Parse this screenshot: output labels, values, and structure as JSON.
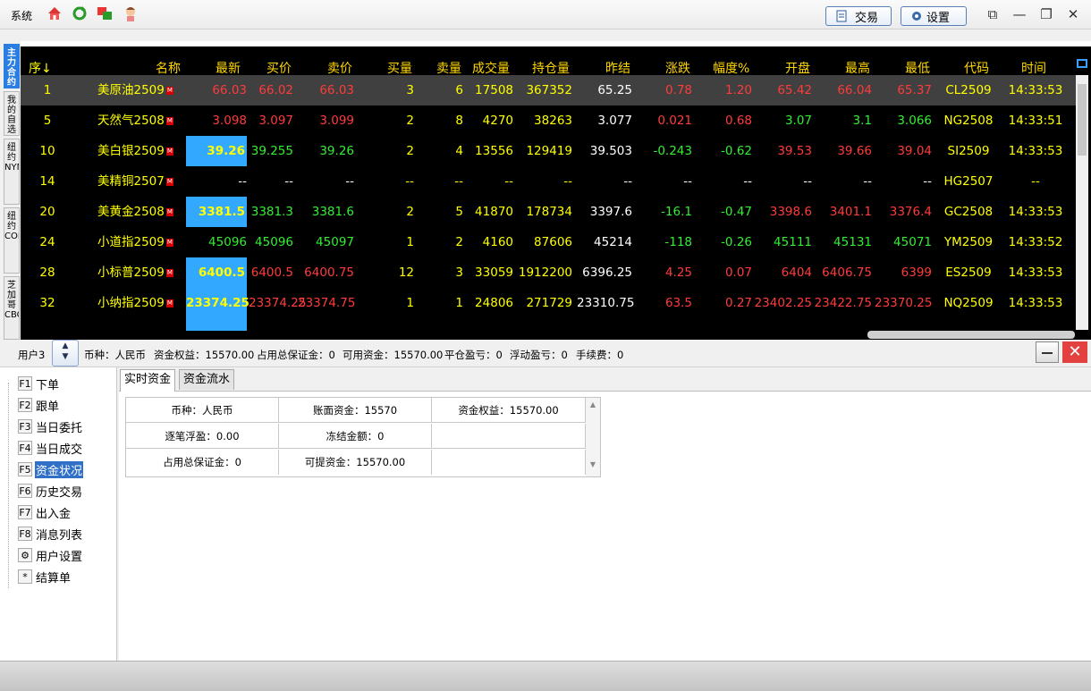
{
  "titlebar": {
    "menu_system": "系统",
    "icons": [
      "home-icon",
      "refresh-icon",
      "windows-icon",
      "user-avatar-icon"
    ],
    "trade_label": "交易",
    "settings_label": "设置"
  },
  "side_tabs": [
    "主力合约",
    "我的自选",
    "纽约NYMEX",
    "纽约COMEX",
    "芝加哥CBOT"
  ],
  "grid": {
    "headers": [
      "序↓",
      "名称",
      "最新",
      "买价",
      "卖价",
      "买量",
      "卖量",
      "成交量",
      "持仓量",
      "昨结",
      "涨跌",
      "幅度%",
      "开盘",
      "最高",
      "最低",
      "代码",
      "时间"
    ],
    "rows": [
      {
        "seq": "1",
        "name": "美原油2509",
        "last": "66.03",
        "bid": "66.02",
        "ask": "66.03",
        "bidv": "3",
        "askv": "6",
        "vol": "17508",
        "oi": "367352",
        "pre": "65.25",
        "chg": "0.78",
        "pct": "1.20",
        "open": "65.42",
        "high": "66.04",
        "low": "65.37",
        "code": "CL2509",
        "time": "14:33:53",
        "dir": "up",
        "hi": false
      },
      {
        "seq": "5",
        "name": "天然气2508",
        "last": "3.098",
        "bid": "3.097",
        "ask": "3.099",
        "bidv": "2",
        "askv": "8",
        "vol": "4270",
        "oi": "38263",
        "pre": "3.077",
        "chg": "0.021",
        "pct": "0.68",
        "open": "3.07",
        "high": "3.1",
        "low": "3.066",
        "code": "NG2508",
        "time": "14:33:51",
        "dir": "up",
        "hi": false
      },
      {
        "seq": "10",
        "name": "美白银2509",
        "last": "39.26",
        "bid": "39.255",
        "ask": "39.26",
        "bidv": "2",
        "askv": "4",
        "vol": "13556",
        "oi": "129419",
        "pre": "39.503",
        "chg": "-0.243",
        "pct": "-0.62",
        "open": "39.53",
        "high": "39.66",
        "low": "39.04",
        "code": "SI2509",
        "time": "14:33:53",
        "dir": "down",
        "hi": true
      },
      {
        "seq": "14",
        "name": "美精铜2507",
        "last": "--",
        "bid": "--",
        "ask": "--",
        "bidv": "--",
        "askv": "--",
        "vol": "--",
        "oi": "--",
        "pre": "--",
        "chg": "--",
        "pct": "--",
        "open": "--",
        "high": "--",
        "low": "--",
        "code": "HG2507",
        "time": "--",
        "dir": "none",
        "hi": false
      },
      {
        "seq": "20",
        "name": "美黄金2508",
        "last": "3381.5",
        "bid": "3381.3",
        "ask": "3381.6",
        "bidv": "2",
        "askv": "5",
        "vol": "41870",
        "oi": "178734",
        "pre": "3397.6",
        "chg": "-16.1",
        "pct": "-0.47",
        "open": "3398.6",
        "high": "3401.1",
        "low": "3376.4",
        "code": "GC2508",
        "time": "14:33:53",
        "dir": "down",
        "hi": true
      },
      {
        "seq": "24",
        "name": "小道指2509",
        "last": "45096",
        "bid": "45096",
        "ask": "45097",
        "bidv": "1",
        "askv": "2",
        "vol": "4160",
        "oi": "87606",
        "pre": "45214",
        "chg": "-118",
        "pct": "-0.26",
        "open": "45111",
        "high": "45131",
        "low": "45071",
        "code": "YM2509",
        "time": "14:33:52",
        "dir": "down",
        "hi": false
      },
      {
        "seq": "28",
        "name": "小标普2509",
        "last": "6400.5",
        "bid": "6400.5",
        "ask": "6400.75",
        "bidv": "12",
        "askv": "3",
        "vol": "33059",
        "oi": "1912200",
        "pre": "6396.25",
        "chg": "4.25",
        "pct": "0.07",
        "open": "6404",
        "high": "6406.75",
        "low": "6399",
        "code": "ES2509",
        "time": "14:33:53",
        "dir": "up",
        "hi": true
      },
      {
        "seq": "32",
        "name": "小纳指2509",
        "last": "23374.25",
        "bid": "23374.25",
        "ask": "23374.75",
        "bidv": "1",
        "askv": "1",
        "vol": "24806",
        "oi": "271729",
        "pre": "23310.75",
        "chg": "63.5",
        "pct": "0.27",
        "open": "23402.25",
        "high": "23422.75",
        "low": "23370.25",
        "code": "NQ2509",
        "time": "14:33:53",
        "dir": "up",
        "hi": true
      }
    ]
  },
  "account": {
    "user": "用户3",
    "currency": "币种：人民币",
    "equity": "资金权益：15570.00",
    "margin": "占用总保证金：0",
    "available": "可用资金：15570.00",
    "close_pl": "平仓盈亏：0",
    "float_pl": "浮动盈亏：0",
    "fee": "手续费：0"
  },
  "nav": [
    {
      "key": "F1",
      "label": "下单"
    },
    {
      "key": "F2",
      "label": "跟单"
    },
    {
      "key": "F3",
      "label": "当日委托"
    },
    {
      "key": "F4",
      "label": "当日成交"
    },
    {
      "key": "F5",
      "label": "资金状况"
    },
    {
      "key": "F6",
      "label": "历史交易"
    },
    {
      "key": "F7",
      "label": "出入金"
    },
    {
      "key": "F8",
      "label": "消息列表"
    },
    {
      "key": "⚙",
      "label": "用户设置"
    },
    {
      "key": "*",
      "label": "结算单"
    }
  ],
  "tabs": [
    "实时资金",
    "资金流水"
  ],
  "fund": {
    "c1": "币种：人民币",
    "c2": "账面资金：15570",
    "c3": "资金权益：15570.00",
    "c4": "逐笔浮盈：0.00",
    "c5": "冻结金额：0",
    "c6": "占用总保证金：0",
    "c7": "可提资金：15570.00"
  },
  "colors": {
    "up": "#ff3b3b",
    "down": "#33ee33",
    "flat": "#ffffff",
    "label": "#ffff00",
    "highlight": "#33a8ff"
  }
}
